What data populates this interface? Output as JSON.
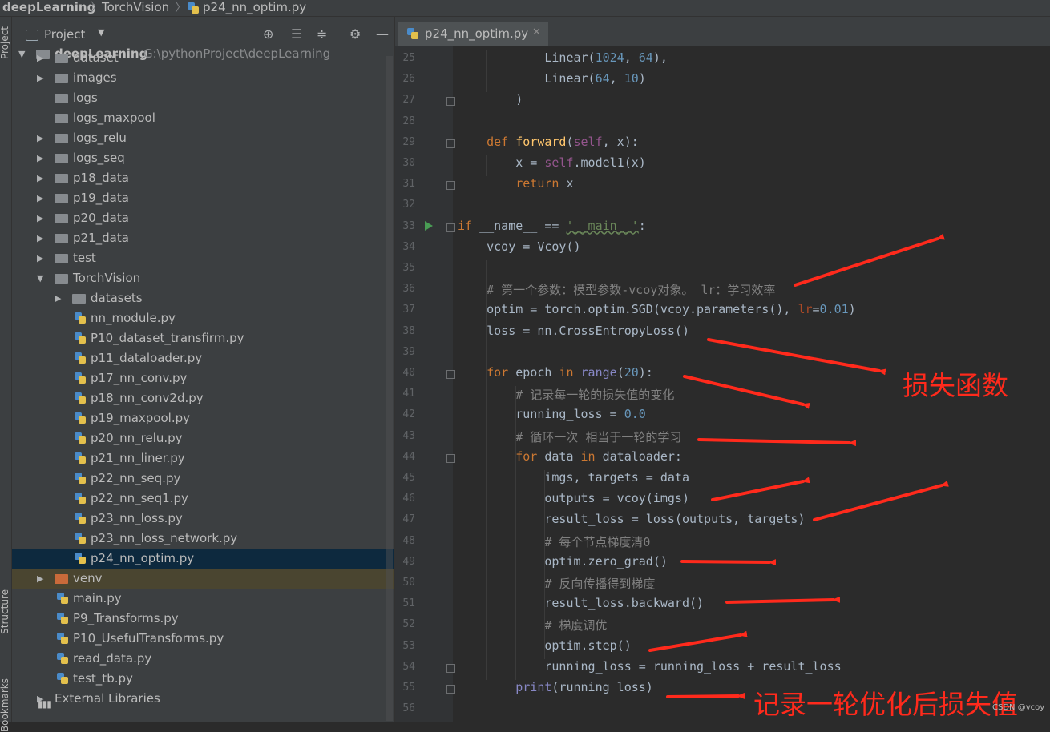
{
  "breadcrumb": {
    "project": "deepLearning",
    "folder": "TorchVision",
    "file": "p24_nn_optim.py"
  },
  "side_strip": {
    "project": "Project",
    "structure": "Structure",
    "bookmarks": "Bookmarks"
  },
  "project_panel": {
    "title": "Project",
    "root": {
      "name": "deepLearning",
      "path": "G:\\pythonProject\\deepLearning"
    },
    "items": [
      {
        "label": "dataset",
        "kind": "folder",
        "expandable": true
      },
      {
        "label": "images",
        "kind": "folder",
        "expandable": true
      },
      {
        "label": "logs",
        "kind": "folder",
        "expandable": false
      },
      {
        "label": "logs_maxpool",
        "kind": "folder",
        "expandable": false
      },
      {
        "label": "logs_relu",
        "kind": "folder",
        "expandable": true
      },
      {
        "label": "logs_seq",
        "kind": "folder",
        "expandable": true
      },
      {
        "label": "p18_data",
        "kind": "folder",
        "expandable": true
      },
      {
        "label": "p19_data",
        "kind": "folder",
        "expandable": true
      },
      {
        "label": "p20_data",
        "kind": "folder",
        "expandable": true
      },
      {
        "label": "p21_data",
        "kind": "folder",
        "expandable": true
      },
      {
        "label": "test",
        "kind": "folder",
        "expandable": true
      },
      {
        "label": "TorchVision",
        "kind": "folder",
        "expanded": true
      },
      {
        "label": "datasets",
        "kind": "folder",
        "expandable": true
      },
      {
        "label": "nn_module.py",
        "kind": "py"
      },
      {
        "label": "P10_dataset_transfirm.py",
        "kind": "py"
      },
      {
        "label": "p11_dataloader.py",
        "kind": "py"
      },
      {
        "label": "p17_nn_conv.py",
        "kind": "py"
      },
      {
        "label": "p18_nn_conv2d.py",
        "kind": "py"
      },
      {
        "label": "p19_maxpool.py",
        "kind": "py"
      },
      {
        "label": "p20_nn_relu.py",
        "kind": "py"
      },
      {
        "label": "p21_nn_liner.py",
        "kind": "py"
      },
      {
        "label": "p22_nn_seq.py",
        "kind": "py"
      },
      {
        "label": "p22_nn_seq1.py",
        "kind": "py"
      },
      {
        "label": "p23_nn_loss.py",
        "kind": "py"
      },
      {
        "label": "p23_nn_loss_network.py",
        "kind": "py"
      },
      {
        "label": "p24_nn_optim.py",
        "kind": "py",
        "selected": true
      },
      {
        "label": "venv",
        "kind": "folder-excluded",
        "expandable": true
      },
      {
        "label": "main.py",
        "kind": "py"
      },
      {
        "label": "P9_Transforms.py",
        "kind": "py"
      },
      {
        "label": "P10_UsefulTransforms.py",
        "kind": "py"
      },
      {
        "label": "read_data.py",
        "kind": "py"
      },
      {
        "label": "test_tb.py",
        "kind": "py"
      },
      {
        "label": "External Libraries",
        "kind": "library",
        "expandable": true
      }
    ]
  },
  "editor": {
    "tab_label": "p24_nn_optim.py",
    "line_numbers": [
      "25",
      "26",
      "27",
      "28",
      "29",
      "30",
      "31",
      "32",
      "33",
      "34",
      "35",
      "36",
      "37",
      "38",
      "39",
      "40",
      "41",
      "42",
      "43",
      "44",
      "45",
      "46",
      "47",
      "48",
      "49",
      "50",
      "51",
      "52",
      "53",
      "54",
      "55",
      "56"
    ],
    "code_lines": [
      "            Linear(1024, 64),",
      "            Linear(64, 10)",
      "        )",
      "",
      "    def forward(self, x):",
      "        x = self.model1(x)",
      "        return x",
      "",
      "if __name__ == '__main__':",
      "    vcoy = Vcoy()",
      "",
      "    # 第一个参数：模型参数-vcoy对象。 lr：学习效率",
      "    optim = torch.optim.SGD(vcoy.parameters(), lr=0.01)",
      "    loss = nn.CrossEntropyLoss()",
      "",
      "    for epoch in range(20):",
      "        # 记录每一轮的损失值的变化",
      "        running_loss = 0.0",
      "        # 循环一次 相当于一轮的学习",
      "        for data in dataloader:",
      "            imgs, targets = data",
      "            outputs = vcoy(imgs)",
      "            result_loss = loss(outputs, targets)",
      "            # 每个节点梯度清0",
      "            optim.zero_grad()",
      "            # 反向传播得到梯度",
      "            result_loss.backward()",
      "            # 梯度调优",
      "            optim.step()",
      "            running_loss = running_loss + result_loss",
      "        print(running_loss)",
      ""
    ]
  },
  "annotations": {
    "loss_function": "损失函数",
    "record_loss": "记录一轮优化后损失值",
    "color": "#ff2a1c"
  },
  "watermark": "CSDN @vcoy",
  "colors": {
    "keyword": "#cc7832",
    "number": "#6897bb",
    "string": "#6a8759",
    "comment": "#808080",
    "function": "#ffc66d",
    "self": "#94558d",
    "selection": "#0d293e"
  }
}
